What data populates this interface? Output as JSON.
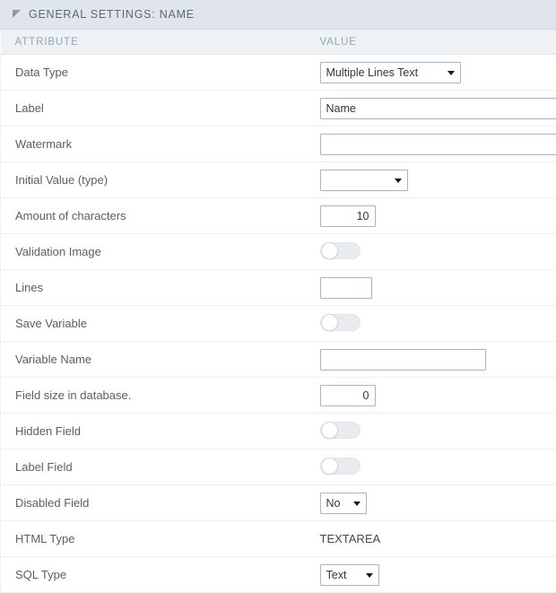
{
  "panel": {
    "title": "GENERAL SETTINGS: NAME",
    "collapse_icon": "triangle-collapse-icon"
  },
  "table": {
    "headers": {
      "attribute": "ATTRIBUTE",
      "value": "VALUE"
    },
    "rows": [
      {
        "attribute": "Data Type",
        "control": "select",
        "value": "Multiple Lines Text"
      },
      {
        "attribute": "Label",
        "control": "text",
        "value": "Name"
      },
      {
        "attribute": "Watermark",
        "control": "text",
        "value": ""
      },
      {
        "attribute": "Initial Value (type)",
        "control": "select",
        "value": ""
      },
      {
        "attribute": "Amount of characters",
        "control": "number",
        "value": "10"
      },
      {
        "attribute": "Validation Image",
        "control": "toggle",
        "value": "off"
      },
      {
        "attribute": "Lines",
        "control": "text-small",
        "value": ""
      },
      {
        "attribute": "Save Variable",
        "control": "toggle",
        "value": "off"
      },
      {
        "attribute": "Variable Name",
        "control": "text-medium",
        "value": ""
      },
      {
        "attribute": "Field size in database.",
        "control": "number",
        "value": "0"
      },
      {
        "attribute": "Hidden Field",
        "control": "toggle",
        "value": "off"
      },
      {
        "attribute": "Label Field",
        "control": "toggle",
        "value": "off"
      },
      {
        "attribute": "Disabled Field",
        "control": "select-small",
        "value": "No"
      },
      {
        "attribute": "HTML Type",
        "control": "static",
        "value": "TEXTAREA"
      },
      {
        "attribute": "SQL Type",
        "control": "select-sqltype",
        "value": "Text"
      }
    ]
  },
  "colors": {
    "title_bar": "#dfe5eb",
    "header_row": "#eef2f5",
    "header_text": "#8ba7bd",
    "label_text": "#55606d",
    "control_border": "#aab6c2",
    "toggle_track": "#e9ecef"
  }
}
